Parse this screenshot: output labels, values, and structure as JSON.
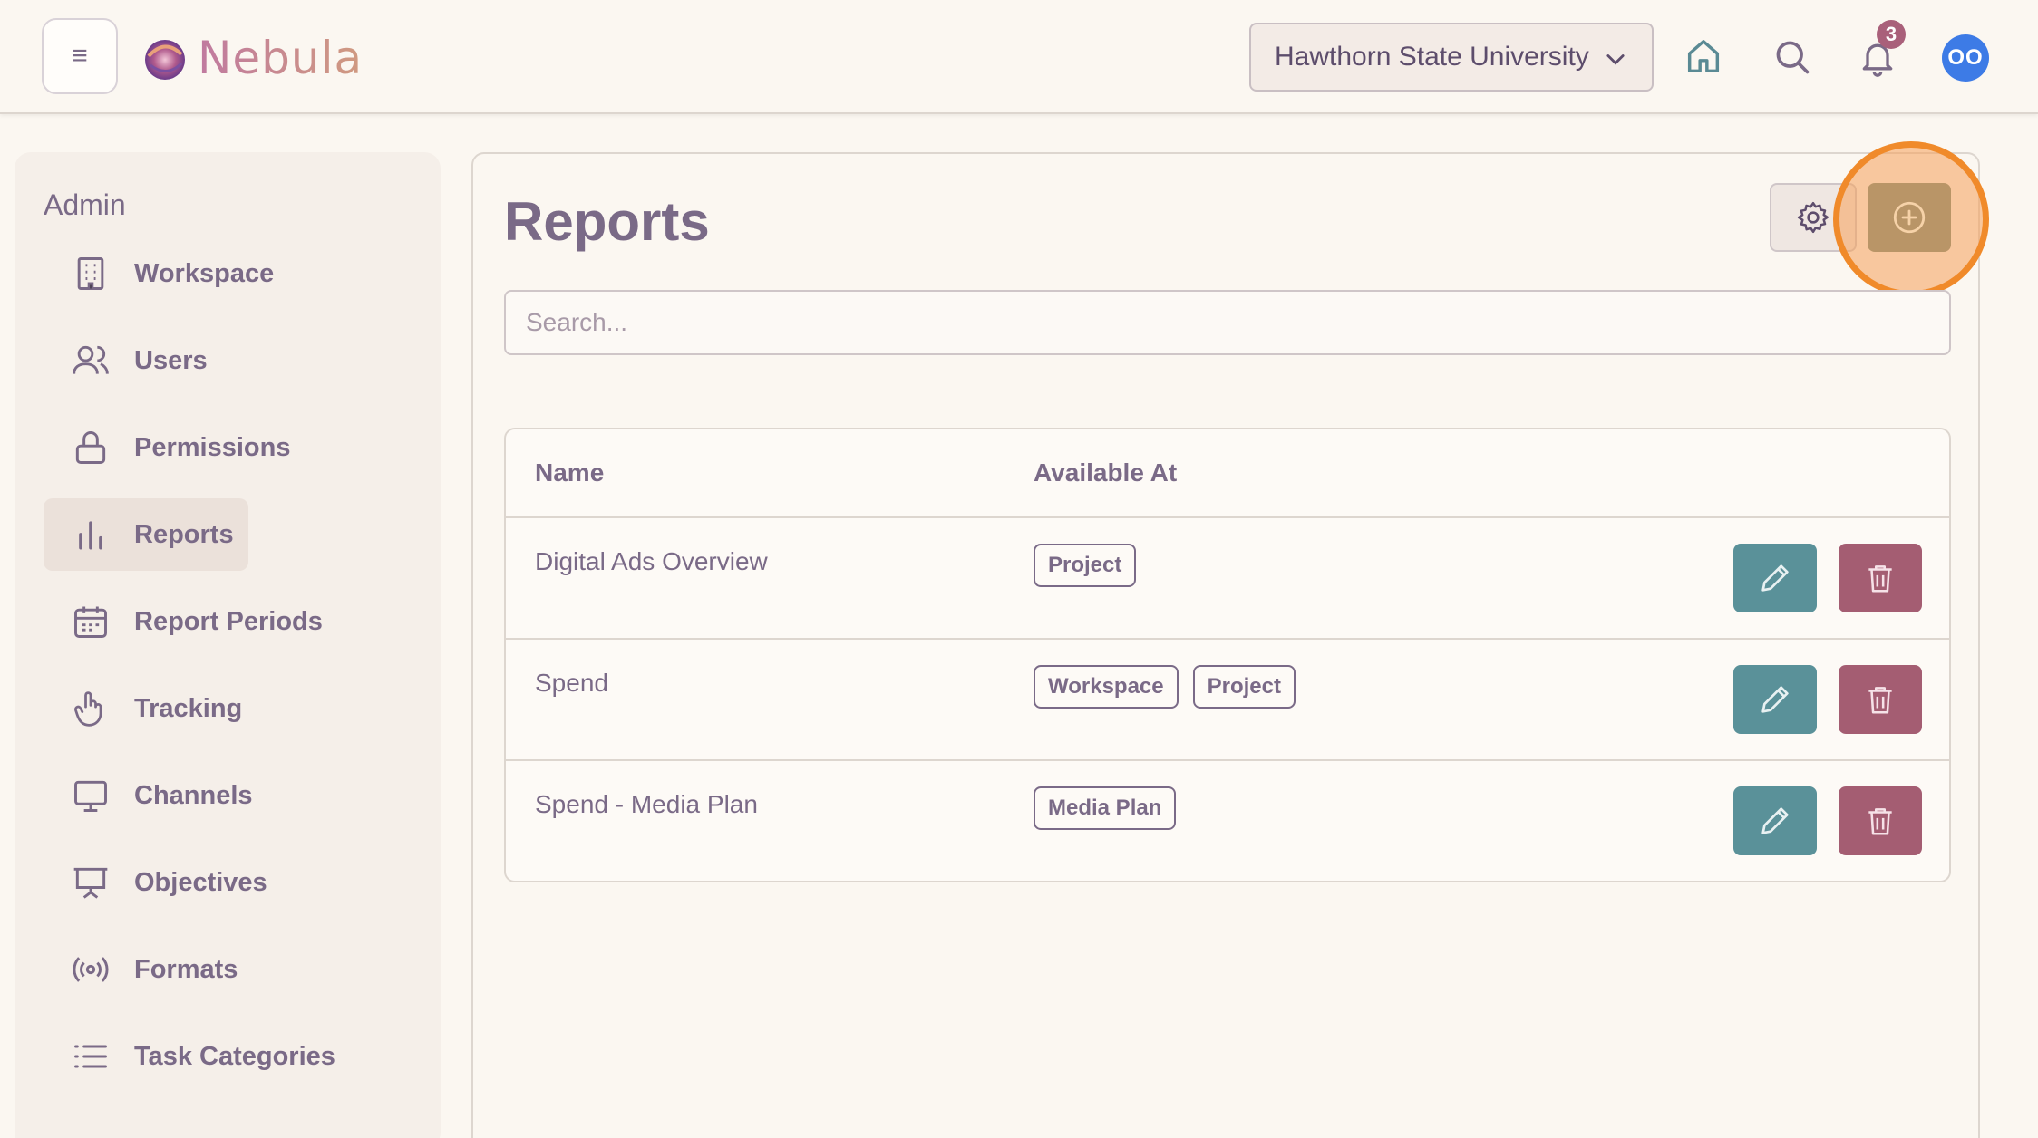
{
  "header": {
    "menu_icon": "hamburger-icon",
    "logo_text": "Nebula",
    "org_selector": {
      "value": "Hawthorn State University"
    },
    "notifications_count": "3",
    "avatar_initials": "OO"
  },
  "sidebar": {
    "title": "Admin",
    "items": [
      {
        "label": "Workspace",
        "icon": "building-icon"
      },
      {
        "label": "Users",
        "icon": "users-icon"
      },
      {
        "label": "Permissions",
        "icon": "lock-icon"
      },
      {
        "label": "Reports",
        "icon": "bar-chart-icon",
        "active": true
      },
      {
        "label": "Report Periods",
        "icon": "calendar-icon"
      },
      {
        "label": "Tracking",
        "icon": "pointer-hand-icon"
      },
      {
        "label": "Channels",
        "icon": "monitor-icon"
      },
      {
        "label": "Objectives",
        "icon": "presentation-icon"
      },
      {
        "label": "Formats",
        "icon": "broadcast-icon"
      },
      {
        "label": "Task Categories",
        "icon": "list-icon"
      }
    ]
  },
  "main": {
    "title": "Reports",
    "search_placeholder": "Search...",
    "table": {
      "headers": [
        "Name",
        "Available At"
      ],
      "rows": [
        {
          "name": "Digital Ads Overview",
          "tags": [
            "Project"
          ]
        },
        {
          "name": "Spend",
          "tags": [
            "Workspace",
            "Project"
          ]
        },
        {
          "name": "Spend - Media Plan",
          "tags": [
            "Media Plan"
          ]
        }
      ]
    }
  },
  "colors": {
    "accent_add": "#b99567",
    "highlight": "#f08a2a",
    "edit": "#5a9199",
    "delete": "#a45d72",
    "avatar": "#3d7be6"
  }
}
